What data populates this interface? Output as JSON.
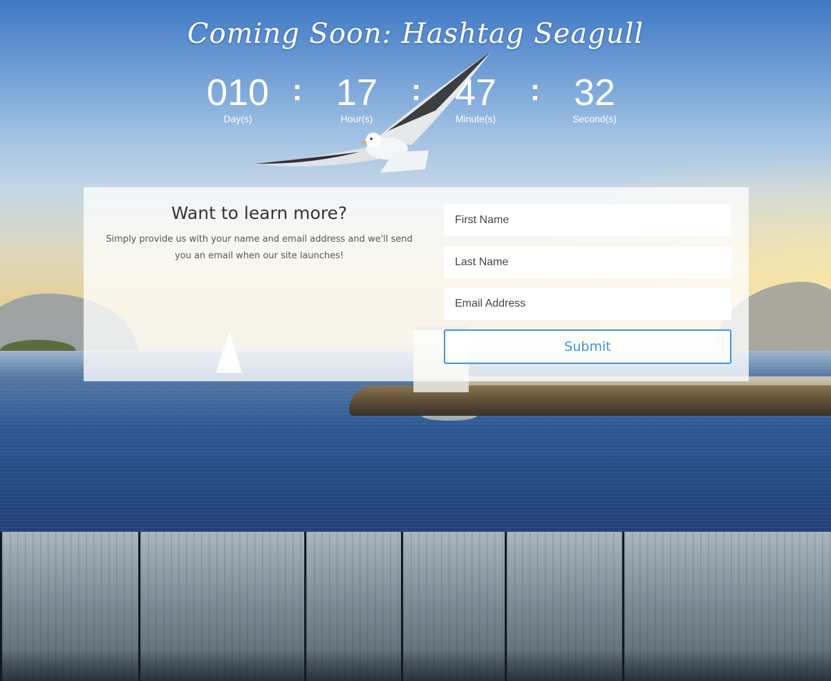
{
  "page": {
    "title": "Coming Soon: Hashtag Seagull"
  },
  "countdown": {
    "days": {
      "value": "010",
      "label": "Day(s)"
    },
    "hours": {
      "value": "17",
      "label": "Hour(s)"
    },
    "minutes": {
      "value": "47",
      "label": "Minute(s)"
    },
    "seconds": {
      "value": "32",
      "label": "Second(s)"
    },
    "separator": ":"
  },
  "signup": {
    "heading": "Want to learn more?",
    "description": "Simply provide us with your name and email address and we'll send you an email when our site launches!",
    "first_name_placeholder": "First Name",
    "last_name_placeholder": "Last Name",
    "email_placeholder": "Email Address",
    "submit_label": "Submit"
  },
  "colors": {
    "accent": "#3d96d8",
    "panel_text": "#333333",
    "sky_top": "#3f79c4",
    "sea": "#2b5592"
  },
  "icons": {
    "hero": "seagull-illustration"
  }
}
